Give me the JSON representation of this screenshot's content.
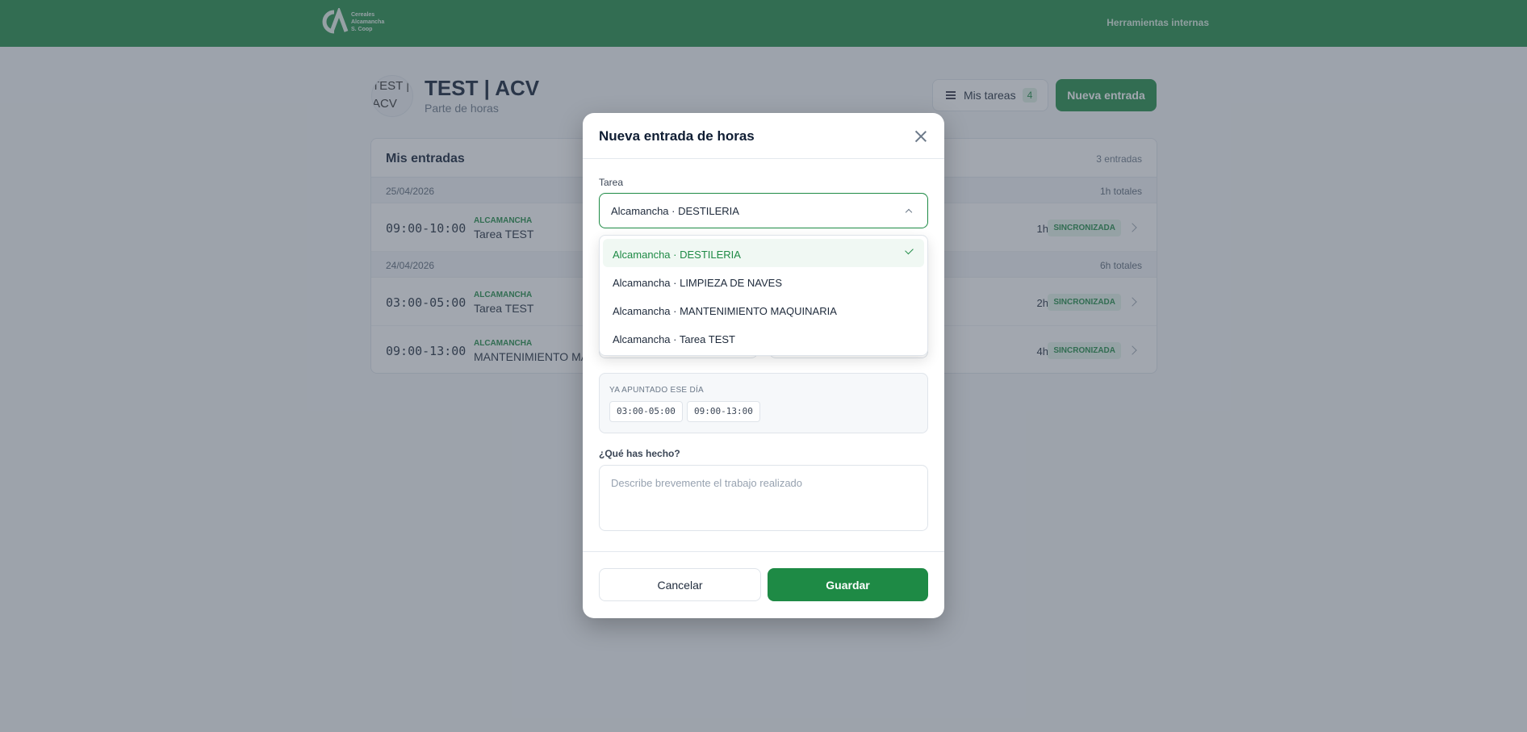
{
  "header": {
    "logo_text": [
      "Cereales",
      "Alcamancha",
      "S. Coop"
    ],
    "nav_label": "Herramientas internas"
  },
  "page": {
    "avatar_alt": "TEST | ACV",
    "title": "TEST | ACV",
    "subtitle": "Parte de horas",
    "tasks_button": "Mis tareas",
    "tasks_count": "4",
    "new_button": "Nueva entrada"
  },
  "entries": {
    "title": "Mis entradas",
    "count": "3 entradas",
    "days": [
      {
        "date": "25/04/2026",
        "total": "1h totales",
        "rows": [
          {
            "time": "09:00-10:00",
            "org": "ALCAMANCHA",
            "task": "Tarea TEST",
            "hours": "1h",
            "status": "SINCRONIZADA"
          }
        ]
      },
      {
        "date": "24/04/2026",
        "total": "6h totales",
        "rows": [
          {
            "time": "03:00-05:00",
            "org": "ALCAMANCHA",
            "task": "Tarea TEST",
            "hours": "2h",
            "status": "SINCRONIZADA"
          },
          {
            "time": "09:00-13:00",
            "org": "ALCAMANCHA",
            "task": "MANTENIMIENTO MA",
            "hours": "4h",
            "status": "SINCRONIZADA"
          }
        ]
      }
    ]
  },
  "modal": {
    "title": "Nueva entrada de horas",
    "task_label": "Tarea",
    "task_value": "Alcamancha · DESTILERIA",
    "options": [
      "Alcamancha · DESTILERIA",
      "Alcamancha · LIMPIEZA DE NAVES",
      "Alcamancha · MANTENIMIENTO MAQUINARIA",
      "Alcamancha · Tarea TEST"
    ],
    "selected_option": "Alcamancha · DESTILERIA",
    "booked_title": "YA APUNTADO ESE DÍA",
    "booked_slots": [
      "03:00-05:00",
      "09:00-13:00"
    ],
    "description_label": "¿Qué has hecho?",
    "description_placeholder": "Describe brevemente el trabajo realizado",
    "cancel_label": "Cancelar",
    "save_label": "Guardar"
  },
  "colors": {
    "brand": "#1e8a45",
    "overlay": "rgba(70,80,95,0.5)"
  }
}
